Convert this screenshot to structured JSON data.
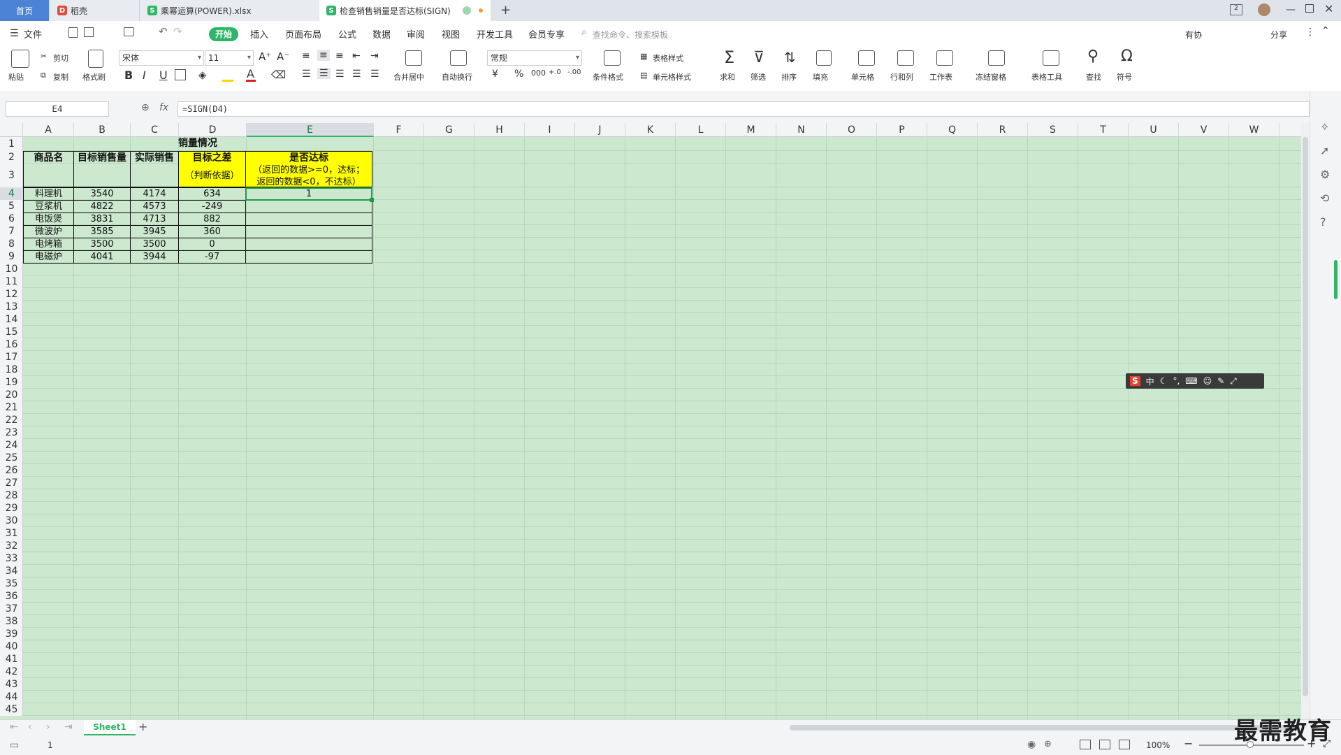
{
  "tabs": [
    {
      "label": "首页"
    },
    {
      "label": "稻壳"
    },
    {
      "label": "乘幂运算(POWER).xlsx"
    },
    {
      "label": "检查销售销量是否达标(SIGN)"
    }
  ],
  "menu": [
    "文件",
    "开始",
    "插入",
    "页面布局",
    "公式",
    "数据",
    "审阅",
    "视图",
    "开发工具",
    "会员专享"
  ],
  "search_placeholder": "查找命令、搜索模板",
  "top_right": {
    "sync": "有协",
    "share": "分享"
  },
  "ribbon": {
    "paste": "粘贴",
    "cut": "剪切",
    "copy": "复制",
    "format_painter": "格式刷",
    "font_name": "宋体",
    "font_size": "11",
    "merge": "合并居中",
    "wrap": "自动换行",
    "number_format": "常规",
    "cond_format": "条件格式",
    "table_style": "表格样式",
    "cell_style": "单元格样式",
    "sum": "求和",
    "filter": "筛选",
    "sort": "排序",
    "fill": "填充",
    "cell": "单元格",
    "rowcol": "行和列",
    "sheet": "工作表",
    "freeze": "冻结窗格",
    "table_tools": "表格工具",
    "find": "查找",
    "symbol": "符号"
  },
  "namebox": "E4",
  "formula": "=SIGN(D4)",
  "columns": [
    "A",
    "B",
    "C",
    "D",
    "E",
    "F",
    "G",
    "H",
    "I",
    "J",
    "K",
    "L",
    "M",
    "N",
    "O",
    "P",
    "Q",
    "R",
    "S",
    "T",
    "U",
    "V",
    "W"
  ],
  "selected_column": "E",
  "selected_row": "4",
  "table": {
    "title": "销量情况",
    "headers": {
      "a": "商品名",
      "b": "目标销售量",
      "c": "实际销售",
      "d": "目标之差",
      "d_note": "（判断依据）",
      "e": "是否达标",
      "e_note1": "（返回的数据>=0，达标；",
      "e_note2": "返回的数据<0，不达标）"
    },
    "rows": [
      {
        "name": "料理机",
        "target": "3540",
        "actual": "4174",
        "diff": "634",
        "result": "1"
      },
      {
        "name": "豆浆机",
        "target": "4822",
        "actual": "4573",
        "diff": "-249",
        "result": ""
      },
      {
        "name": "电饭煲",
        "target": "3831",
        "actual": "4713",
        "diff": "882",
        "result": ""
      },
      {
        "name": "微波炉",
        "target": "3585",
        "actual": "3945",
        "diff": "360",
        "result": ""
      },
      {
        "name": "电烤箱",
        "target": "3500",
        "actual": "3500",
        "diff": "0",
        "result": ""
      },
      {
        "name": "电磁炉",
        "target": "4041",
        "actual": "3944",
        "diff": "-97",
        "result": ""
      }
    ]
  },
  "sheet_tab": "Sheet1",
  "status": {
    "count": "1",
    "zoom": "100%"
  },
  "ime": {
    "label": "中"
  },
  "watermark": "最需教育",
  "colors": {
    "accent": "#2fb567",
    "sheet_bg": "#cce8cf",
    "highlight": "#ffff00",
    "home_tab": "#4b82d6"
  }
}
